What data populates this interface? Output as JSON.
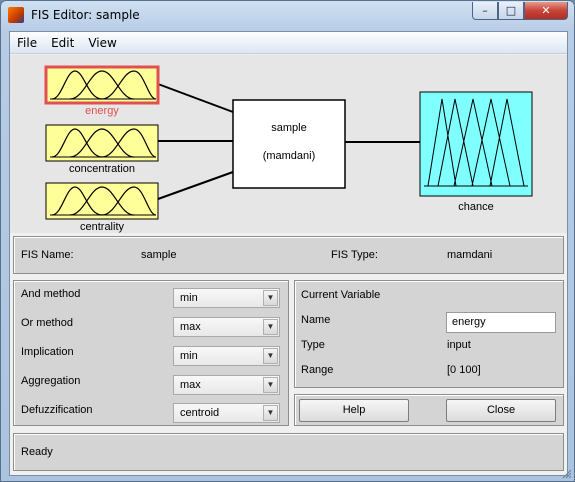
{
  "window": {
    "title": "FIS Editor: sample"
  },
  "menu": {
    "items": [
      {
        "label": "File"
      },
      {
        "label": "Edit"
      },
      {
        "label": "View"
      }
    ]
  },
  "diagram": {
    "inputs": [
      {
        "name": "energy",
        "selected": true
      },
      {
        "name": "concentration",
        "selected": false
      },
      {
        "name": "centrality",
        "selected": false
      }
    ],
    "system": {
      "name": "sample",
      "type_label": "(mamdani)"
    },
    "output": {
      "name": "chance"
    },
    "colors": {
      "input_fill": "#ffff99",
      "output_fill": "#80ffff",
      "selected_border": "#e05050",
      "selected_text": "#e05050"
    }
  },
  "fis_info": {
    "name_label": "FIS Name:",
    "name_value": "sample",
    "type_label": "FIS Type:",
    "type_value": "mamdani"
  },
  "methods": [
    {
      "label": "And method",
      "value": "min"
    },
    {
      "label": "Or method",
      "value": "max"
    },
    {
      "label": "Implication",
      "value": "min"
    },
    {
      "label": "Aggregation",
      "value": "max"
    },
    {
      "label": "Defuzzification",
      "value": "centroid"
    }
  ],
  "current_variable": {
    "header": "Current Variable",
    "name_label": "Name",
    "name_value": "energy",
    "type_label": "Type",
    "type_value": "input",
    "range_label": "Range",
    "range_value": "[0 100]"
  },
  "buttons": {
    "help": "Help",
    "close": "Close"
  },
  "status": {
    "text": "Ready"
  }
}
